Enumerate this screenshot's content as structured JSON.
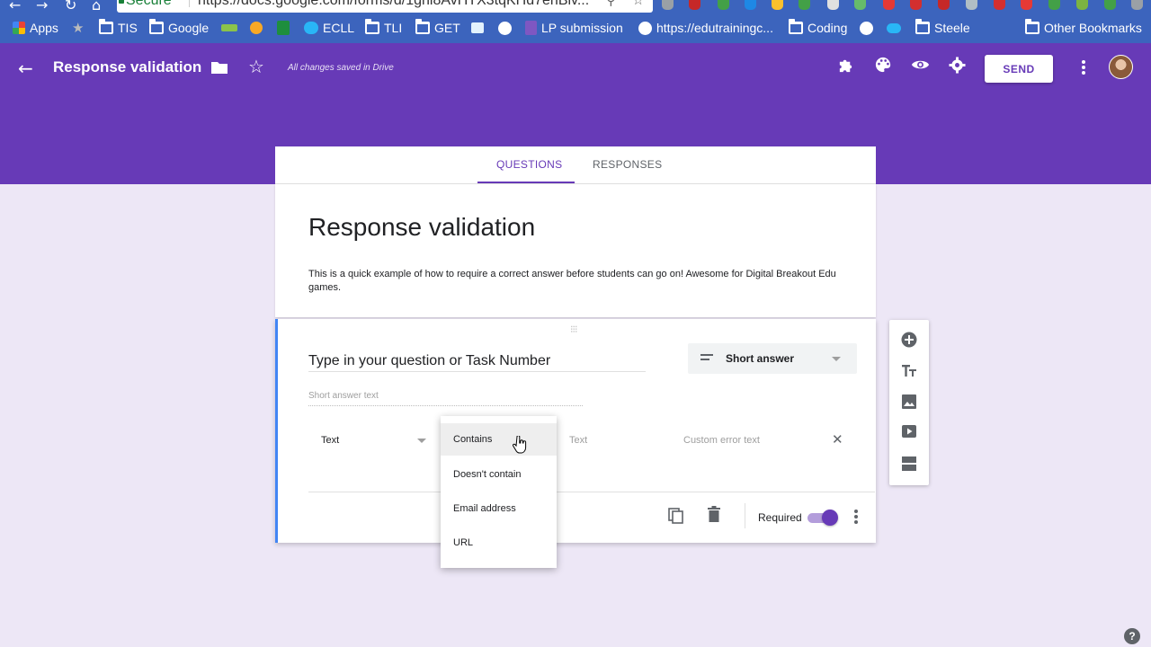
{
  "browser": {
    "secure_label": "Secure",
    "url": "https://docs.google.com/forms/d/1gni8AvHTX3tqKHd7enBiv...",
    "bookmarks": [
      {
        "label": "Apps",
        "icon": "apps-grid-icon"
      },
      {
        "label": "TIS",
        "icon": "folder-icon"
      },
      {
        "label": "Google",
        "icon": "folder-icon"
      },
      {
        "label": "ECLL",
        "icon": "salesforce-icon"
      },
      {
        "label": "TLI",
        "icon": "folder-icon"
      },
      {
        "label": "GET",
        "icon": "folder-icon"
      },
      {
        "label": "LP submission",
        "icon": "forms-icon"
      },
      {
        "label": "https://edutrainingc...",
        "icon": "google-icon"
      },
      {
        "label": "Coding",
        "icon": "folder-icon"
      },
      {
        "label": "Steele",
        "icon": "folder-icon"
      },
      {
        "label": "Other Bookmarks",
        "icon": "folder-icon"
      }
    ]
  },
  "header": {
    "title": "Response validation",
    "saved_status": "All changes saved in Drive",
    "send_label": "SEND",
    "brand_color": "#673ab7",
    "icons": [
      "back-arrow-icon",
      "folder-icon",
      "star-icon",
      "addons-icon",
      "palette-icon",
      "preview-eye-icon",
      "settings-gear-icon",
      "more-vert-icon",
      "avatar"
    ]
  },
  "tabs": [
    {
      "label": "QUESTIONS",
      "active": true
    },
    {
      "label": "RESPONSES",
      "active": false
    }
  ],
  "form": {
    "title": "Response validation",
    "description": "This is a quick example of how to require a correct answer before students can go on! Awesome for Digital Breakout Edu games."
  },
  "question": {
    "title": "Type in your question or Task Number",
    "type": "Short answer",
    "answer_placeholder": "Short answer text",
    "validation": {
      "type": "Text",
      "condition": "Contains",
      "text_placeholder": "Text",
      "error_placeholder": "Custom error text"
    },
    "required_label": "Required",
    "required": true
  },
  "validation_menu": {
    "items": [
      "Contains",
      "Doesn't contain",
      "Email address",
      "URL"
    ],
    "highlighted": "Contains"
  },
  "side_toolbar": [
    "add-question-icon",
    "add-title-icon",
    "add-image-icon",
    "add-video-icon",
    "add-section-icon"
  ],
  "help_glyph": "?"
}
